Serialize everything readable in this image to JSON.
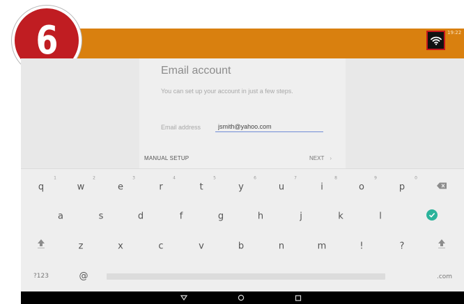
{
  "step_badge": {
    "number": "6"
  },
  "status_bar": {
    "time": "19:22",
    "wifi_icon": "wifi-icon"
  },
  "setup": {
    "title": "Email account",
    "description": "You can set up your account in just a few steps.",
    "email_label": "Email address",
    "email_value": "jsmith@yahoo.com",
    "manual_setup_label": "MANUAL SETUP",
    "next_label": "NEXT",
    "next_chevron": "›"
  },
  "keyboard": {
    "row1": [
      {
        "key": "q",
        "hint": "1"
      },
      {
        "key": "w",
        "hint": "2"
      },
      {
        "key": "e",
        "hint": "3"
      },
      {
        "key": "r",
        "hint": "4"
      },
      {
        "key": "t",
        "hint": "5"
      },
      {
        "key": "y",
        "hint": "6"
      },
      {
        "key": "u",
        "hint": "7"
      },
      {
        "key": "i",
        "hint": "8"
      },
      {
        "key": "o",
        "hint": "9"
      },
      {
        "key": "p",
        "hint": "0"
      }
    ],
    "row2": [
      "a",
      "s",
      "d",
      "f",
      "g",
      "h",
      "j",
      "k",
      "l"
    ],
    "row3": [
      "z",
      "x",
      "c",
      "v",
      "b",
      "n",
      "m",
      "!",
      "?"
    ],
    "symbols_label": "?123",
    "at_label": "@",
    "dotcom_label": ".com",
    "icons": {
      "backspace": "backspace-icon",
      "done": "check-circle-icon",
      "shift": "shift-icon"
    },
    "accent_color": "#2bb39b"
  },
  "nav_bar": {
    "icons": [
      "back-icon",
      "home-icon",
      "recents-icon"
    ]
  },
  "colors": {
    "status_bar": "#d9800f",
    "badge": "#c01d22"
  }
}
